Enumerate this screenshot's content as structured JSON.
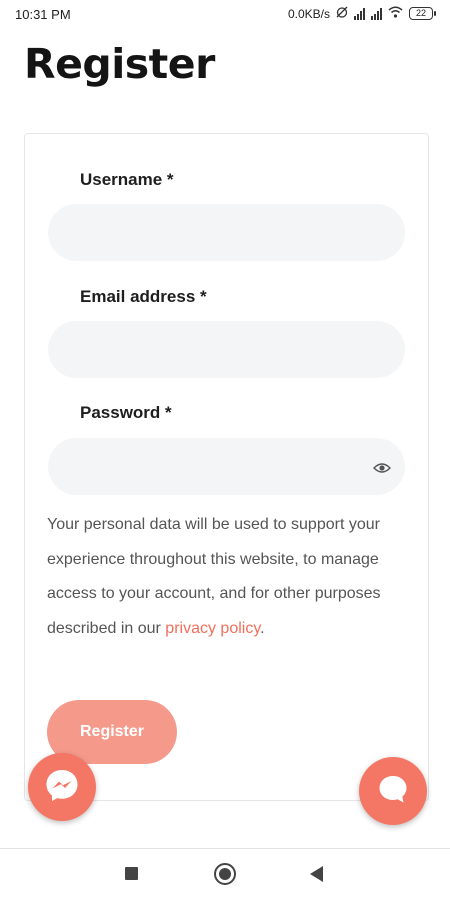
{
  "status_bar": {
    "time": "10:31 PM",
    "network_speed": "0.0KB/s",
    "battery": "22"
  },
  "page": {
    "title": "Register"
  },
  "form": {
    "username_label": "Username *",
    "username_value": "",
    "email_label": "Email address *",
    "email_value": "",
    "password_label": "Password *",
    "password_value": "",
    "privacy_text": "Your personal data will be used to support your experience throughout this website, to manage access to your account, and for other purposes described in our ",
    "privacy_link": "privacy policy",
    "privacy_end": ".",
    "submit_label": "Register"
  },
  "icons": {
    "password_toggle": "eye-icon",
    "messenger": "messenger-icon",
    "chat": "chat-bubble-icon",
    "nav": [
      "recents-icon",
      "home-icon",
      "back-icon"
    ]
  },
  "colors": {
    "accent": "#f26f5c",
    "button": "#f59a8a",
    "fab": "#f47766",
    "input_bg": "#f4f5f7"
  }
}
